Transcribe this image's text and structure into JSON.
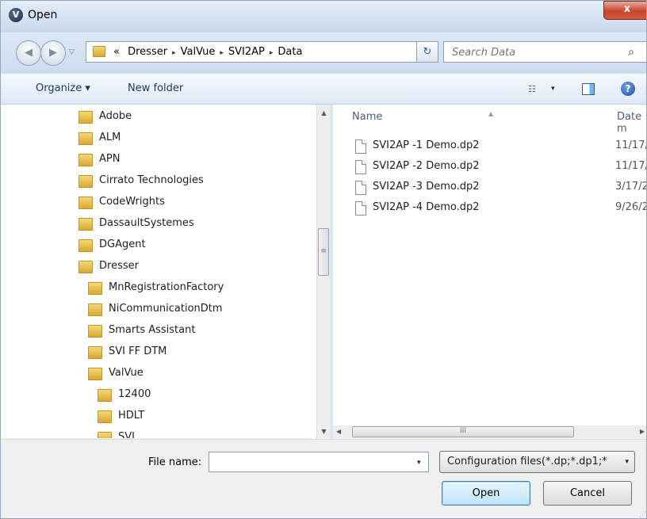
{
  "window": {
    "title": "Open",
    "app_icon": "V",
    "close_glyph": "x"
  },
  "nav": {
    "back_icon": "◀",
    "forward_icon": "▶",
    "recent_dropdown": "▽",
    "breadcrumb": {
      "prefix": "«",
      "segments": [
        "Dresser",
        "ValVue",
        "SVI2AP",
        "Data"
      ],
      "separator": "▸"
    },
    "address_dropdown": "▾",
    "refresh_glyph": "↻",
    "search_placeholder": "Search Data",
    "search_icon": "⌕"
  },
  "toolbar": {
    "organize_label": "Organize ▾",
    "new_folder_label": "New folder",
    "views_icon": "☷",
    "views_dropdown": "▾",
    "help_glyph": "?"
  },
  "tree": {
    "items": [
      {
        "label": "Adobe"
      },
      {
        "label": "ALM"
      },
      {
        "label": "APN"
      },
      {
        "label": "Cirrato Technologies"
      },
      {
        "label": "CodeWrights"
      },
      {
        "label": "DassaultSystemes"
      },
      {
        "label": "DGAgent"
      },
      {
        "label": "Dresser"
      },
      {
        "label": "MnRegistrationFactory"
      },
      {
        "label": "NiCommunicationDtm"
      },
      {
        "label": "Smarts Assistant"
      },
      {
        "label": "SVI FF DTM"
      },
      {
        "label": "ValVue"
      },
      {
        "label": "12400"
      },
      {
        "label": "HDLT"
      },
      {
        "label": "SVI"
      }
    ]
  },
  "scroll": {
    "up": "▲",
    "down": "▼",
    "left": "◀",
    "right": "▶",
    "thumb_grip": "≡",
    "hthumb_grip": "III"
  },
  "files": {
    "columns": {
      "name": "Name",
      "date": "Date m",
      "sort_glyph": "▲"
    },
    "rows": [
      {
        "name": "SVI2AP -1 Demo.dp2",
        "date": "11/17/"
      },
      {
        "name": "SVI2AP -2 Demo.dp2",
        "date": "11/17/"
      },
      {
        "name": "SVI2AP -3 Demo.dp2",
        "date": "3/17/2"
      },
      {
        "name": "SVI2AP -4 Demo.dp2",
        "date": "9/26/2"
      }
    ]
  },
  "bottom": {
    "file_name_label": "File name:",
    "file_name_value": "",
    "file_name_dropdown": "▾",
    "filter_value": "Configuration files(*.dp;*.dp1;*",
    "filter_dropdown": "▾",
    "open_label": "Open",
    "cancel_label": "Cancel",
    "grip": "⋰"
  }
}
